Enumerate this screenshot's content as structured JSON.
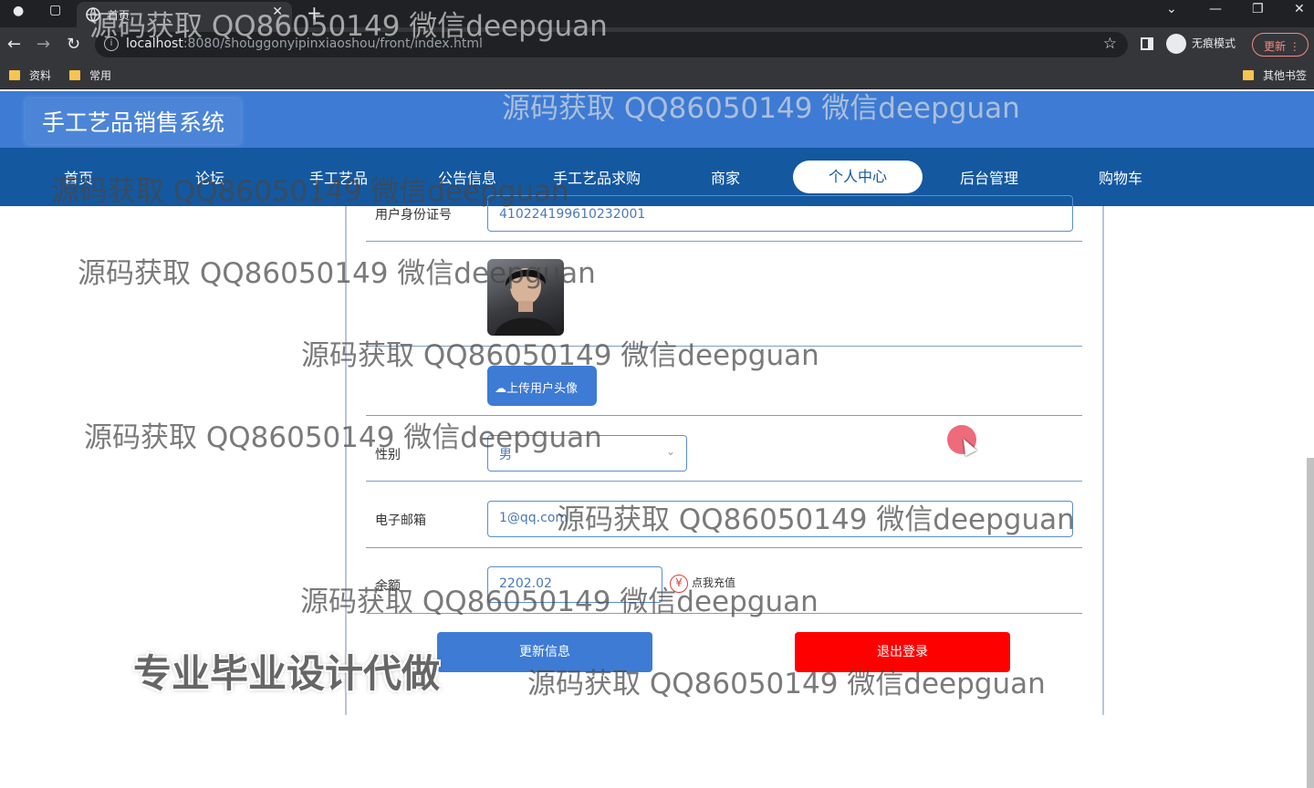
{
  "browser": {
    "tab_title": "首页",
    "url_host": "localhost",
    "url_path": ":8080/shouggonyipinxiaoshou/front/index.html",
    "incognito_label": "无痕模式",
    "update_label": "更新",
    "bookmarks": [
      "资料",
      "常用"
    ],
    "other_bookmarks": "其他书签"
  },
  "site": {
    "title": "手工艺品销售系统",
    "nav": [
      "首页",
      "论坛",
      "手工艺品",
      "公告信息",
      "手工艺品求购",
      "商家",
      "个人中心",
      "后台管理",
      "购物车"
    ],
    "active_nav": "个人中心"
  },
  "form": {
    "id_label": "用户身份证号",
    "id_value": "410224199610232001",
    "upload_label": "上传用户头像",
    "gender_label": "性别",
    "gender_value": "男",
    "email_label": "电子邮箱",
    "email_value": "1@qq.com",
    "balance_label": "余额",
    "balance_value": "2202.02",
    "recharge_label": "点我充值",
    "update_button": "更新信息",
    "logout_button": "退出登录"
  },
  "watermark": {
    "text": "源码获取 QQ86050149 微信deepguan",
    "big_text": "专业毕业设计代做"
  }
}
